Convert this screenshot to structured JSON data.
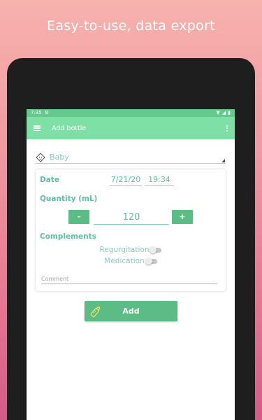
{
  "headline": "Easy-to-use, data export",
  "status_bar": {
    "time": "7:35"
  },
  "app_bar": {
    "title": "Add bottle"
  },
  "baby_select": {
    "value": "Baby"
  },
  "form": {
    "date_label": "Date",
    "date_value": "7/21/20",
    "time_value": "19:34",
    "quantity_label": "Quantity (mL)",
    "minus_label": "-",
    "quantity_value": "120",
    "plus_label": "+",
    "complements_label": "Complements",
    "toggles": [
      {
        "label": "Regurgitation",
        "on": false
      },
      {
        "label": "Medication",
        "on": false
      }
    ],
    "comment_placeholder": "Comment"
  },
  "add_button": {
    "label": "Add"
  },
  "colors": {
    "primary": "#7ee0a6",
    "status_bar": "#63c98d",
    "button": "#5cbc86",
    "accent_text": "#5fc0a0"
  }
}
